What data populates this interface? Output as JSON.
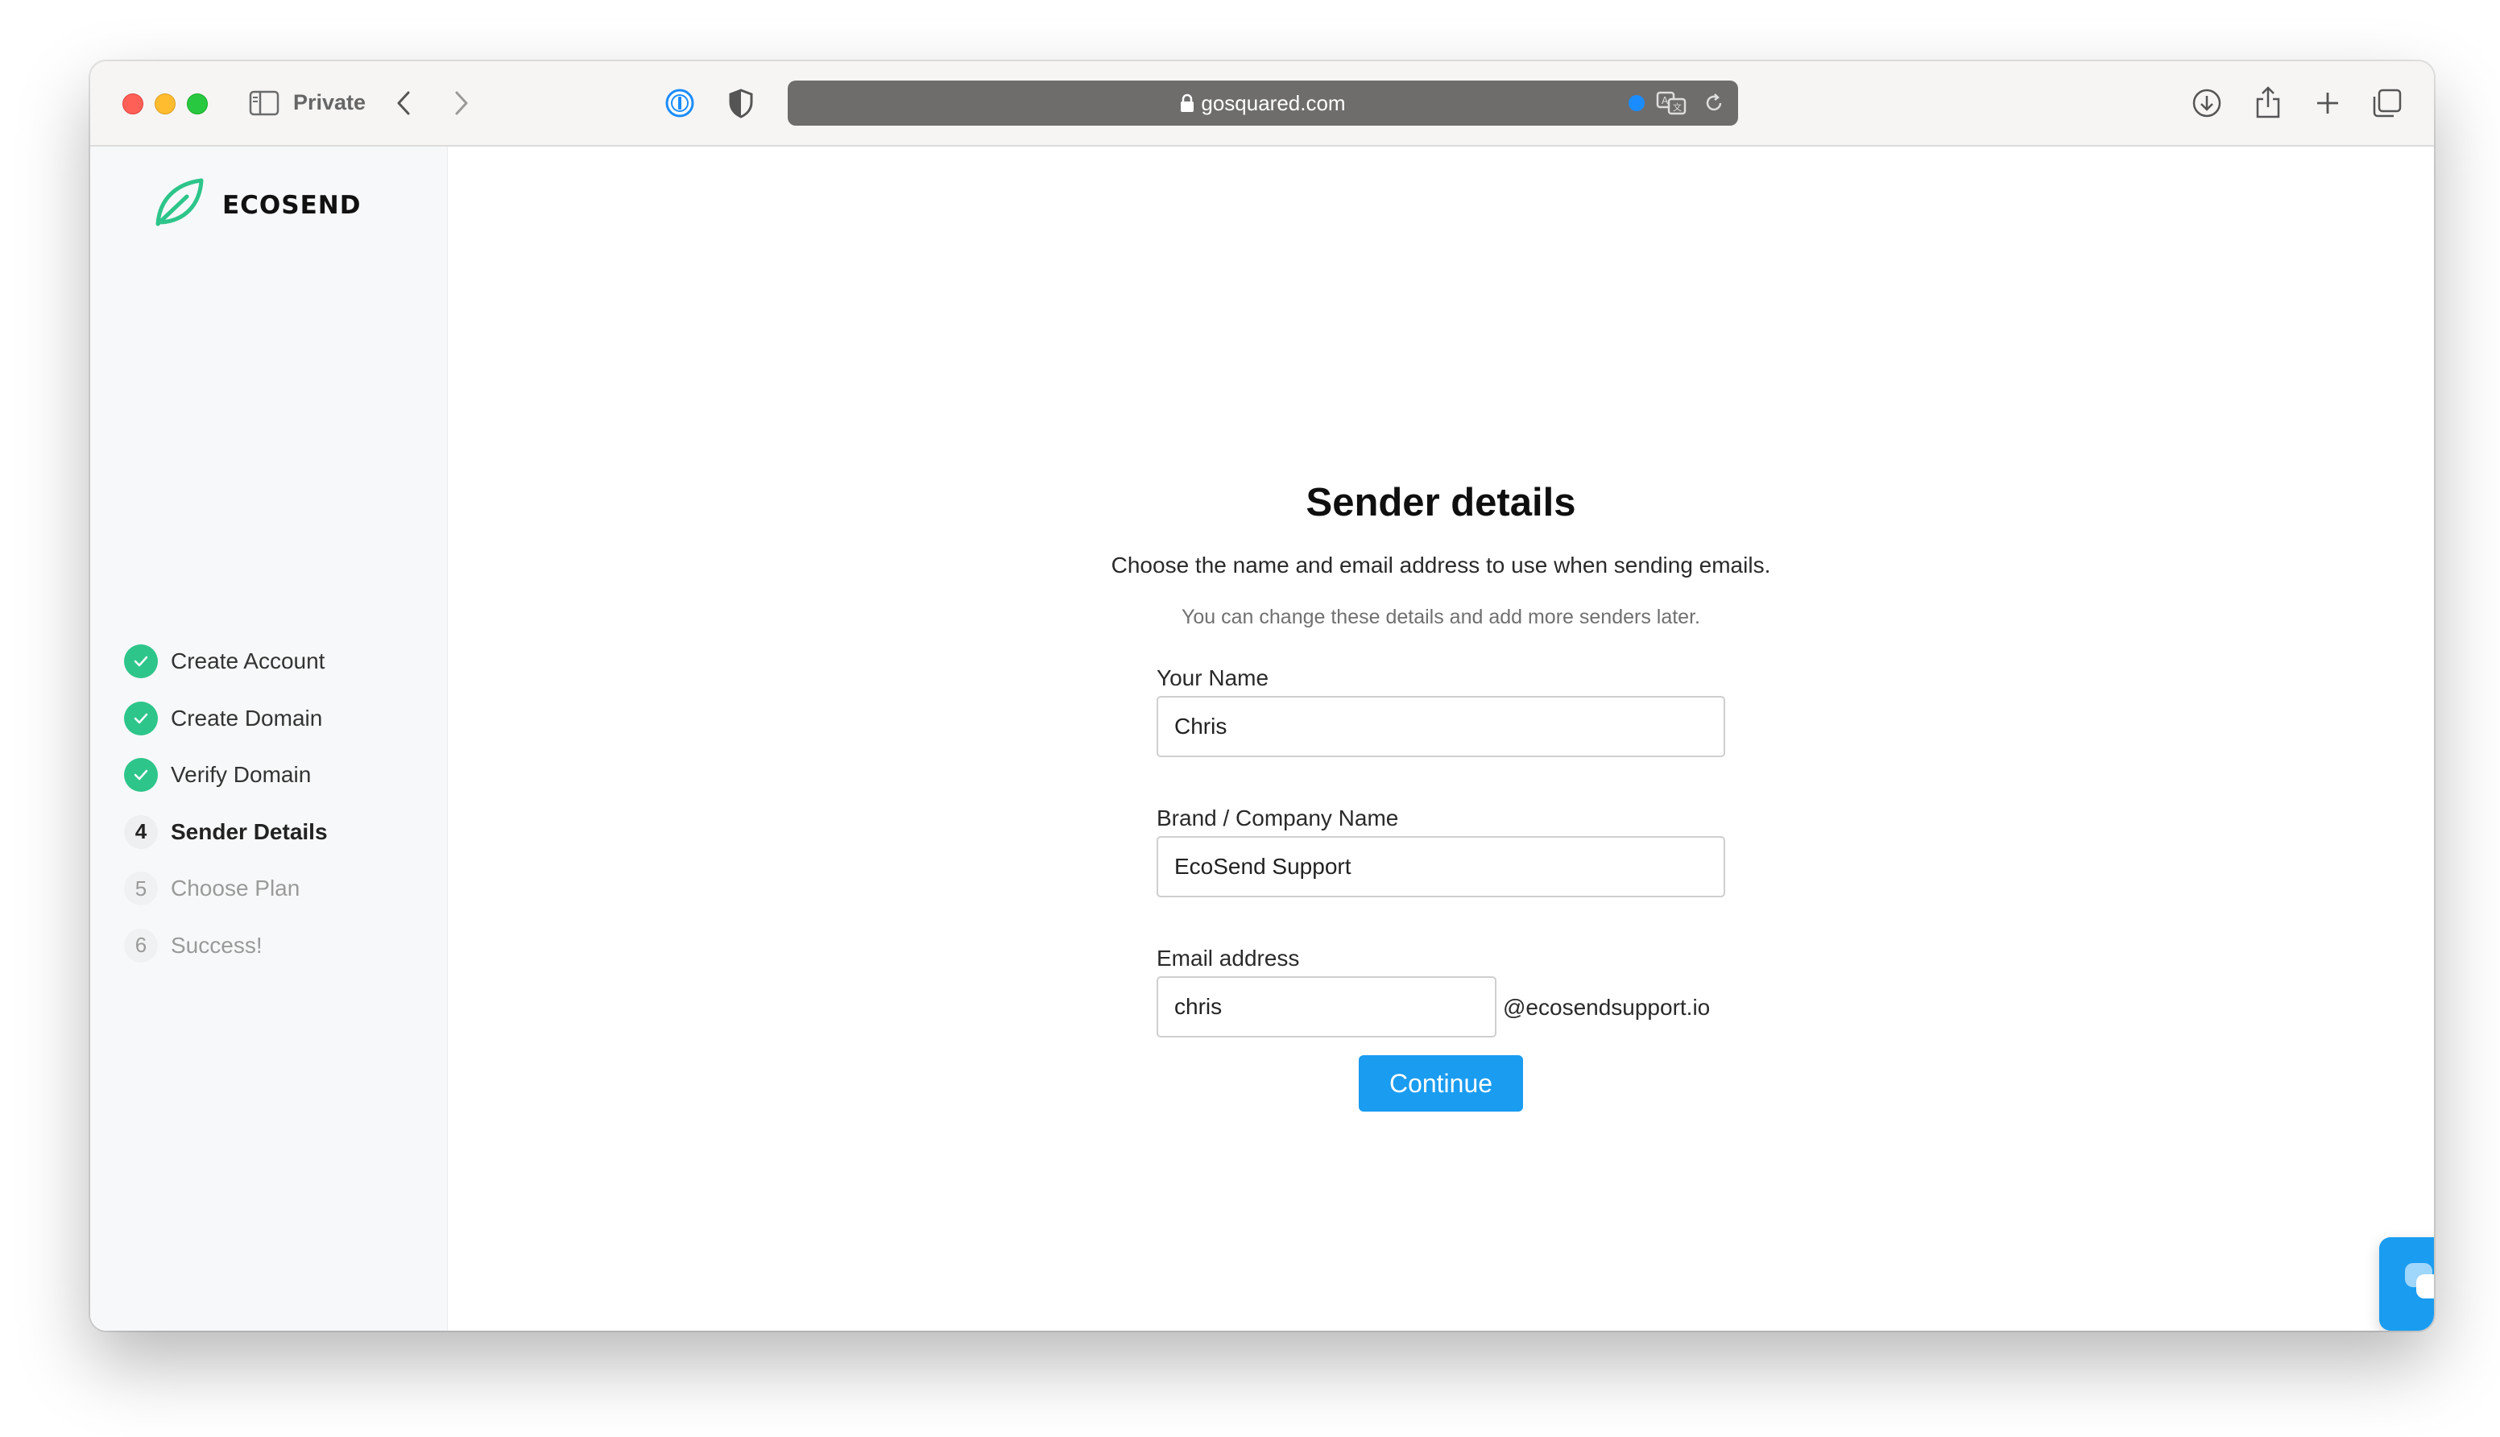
{
  "browser": {
    "private_label": "Private",
    "url": "gosquared.com"
  },
  "brand": {
    "name": "ECOSEND",
    "accent_color": "#2dc58a",
    "button_color": "#1a9cf0"
  },
  "steps": [
    {
      "number": "1",
      "label": "Create Account",
      "state": "done"
    },
    {
      "number": "2",
      "label": "Create Domain",
      "state": "done"
    },
    {
      "number": "3",
      "label": "Verify Domain",
      "state": "done"
    },
    {
      "number": "4",
      "label": "Sender Details",
      "state": "current"
    },
    {
      "number": "5",
      "label": "Choose Plan",
      "state": "todo"
    },
    {
      "number": "6",
      "label": "Success!",
      "state": "todo"
    }
  ],
  "form": {
    "title": "Sender details",
    "subtitle": "Choose the name and email address to use when sending emails.",
    "note": "You can change these details and add more senders later.",
    "your_name_label": "Your Name",
    "your_name_value": "Chris",
    "company_label": "Brand / Company Name",
    "company_value": "EcoSend Support",
    "email_label": "Email address",
    "email_value": "chris",
    "email_domain": "@ecosendsupport.io",
    "continue_label": "Continue"
  }
}
